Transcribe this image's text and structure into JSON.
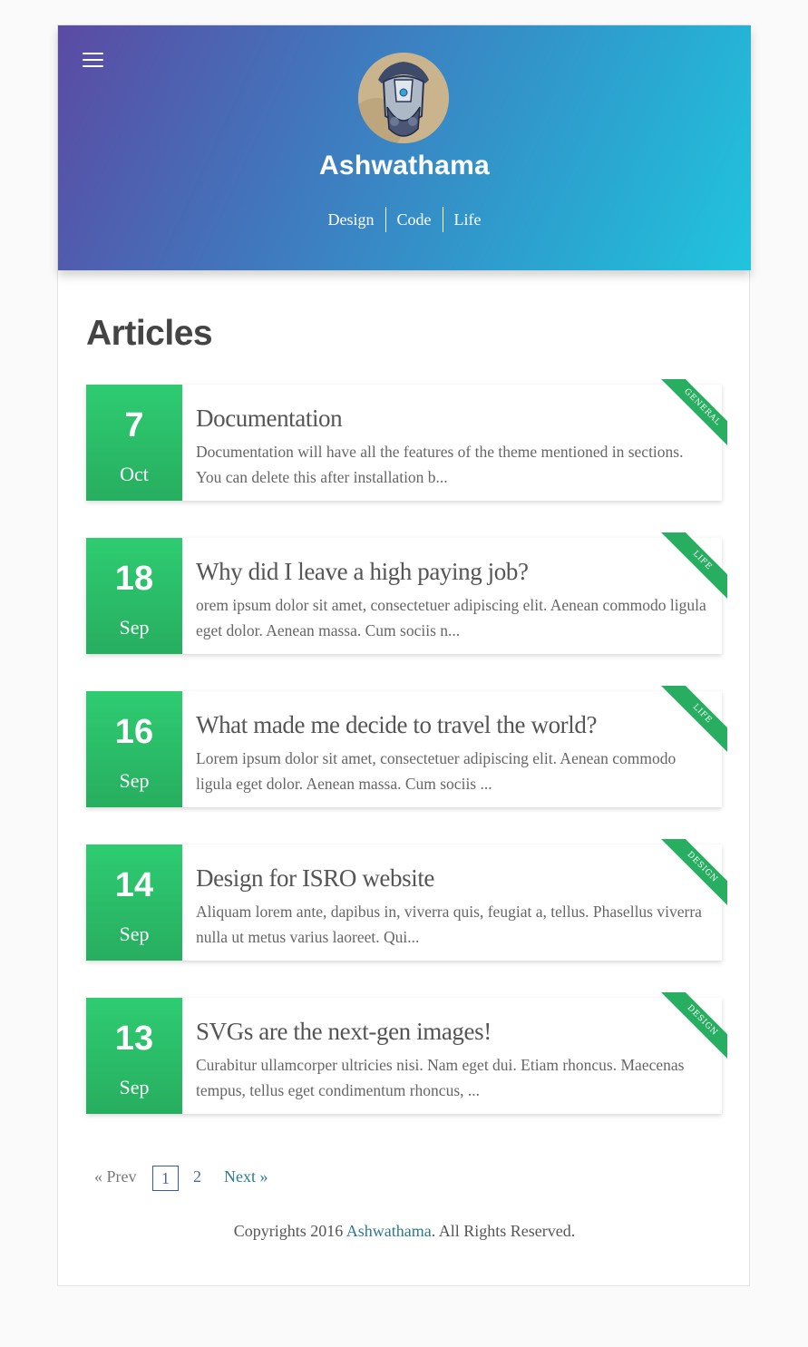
{
  "header": {
    "site_title": "Ashwathama",
    "nav": [
      "Design",
      "Code",
      "Life"
    ]
  },
  "main": {
    "heading": "Articles",
    "articles": [
      {
        "day": "7",
        "month": "Oct",
        "title": "Documentation",
        "excerpt": "Documentation will have all the features of the theme mentioned in sections. You can delete this after installation b...",
        "category": "GENERAL"
      },
      {
        "day": "18",
        "month": "Sep",
        "title": "Why did I leave a high paying job?",
        "excerpt": "orem ipsum dolor sit amet, consectetuer adipiscing elit. Aenean commodo ligula eget dolor. Aenean massa. Cum sociis n...",
        "category": "LIFE"
      },
      {
        "day": "16",
        "month": "Sep",
        "title": "What made me decide to travel the world?",
        "excerpt": "Lorem ipsum dolor sit amet, consectetuer adipiscing elit. Aenean commodo ligula eget dolor. Aenean massa. Cum sociis ...",
        "category": "LIFE"
      },
      {
        "day": "14",
        "month": "Sep",
        "title": "Design for ISRO website",
        "excerpt": "Aliquam lorem ante, dapibus in, viverra quis, feugiat a, tellus. Phasellus viverra nulla ut metus varius laoreet. Qui...",
        "category": "DESIGN"
      },
      {
        "day": "13",
        "month": "Sep",
        "title": "SVGs are the next-gen images!",
        "excerpt": "Curabitur ullamcorper ultricies nisi. Nam eget dui. Etiam rhoncus. Maecenas tempus, tellus eget condimentum rhoncus, ...",
        "category": "DESIGN"
      }
    ]
  },
  "pagination": {
    "prev": "« Prev",
    "pages": [
      "1",
      "2"
    ],
    "current": "1",
    "next": "Next »"
  },
  "footer": {
    "prefix": "Copyrights 2016 ",
    "link": "Ashwathama",
    "suffix": ". All Rights Reserved."
  },
  "colors": {
    "accent_green": "#2ecc71",
    "header_gradient_start": "#5b4aa3",
    "header_gradient_end": "#21c4dd",
    "link": "#2d7a8e"
  },
  "icons": {
    "menu": "hamburger-menu-icon",
    "avatar": "robot-helmet-avatar"
  }
}
